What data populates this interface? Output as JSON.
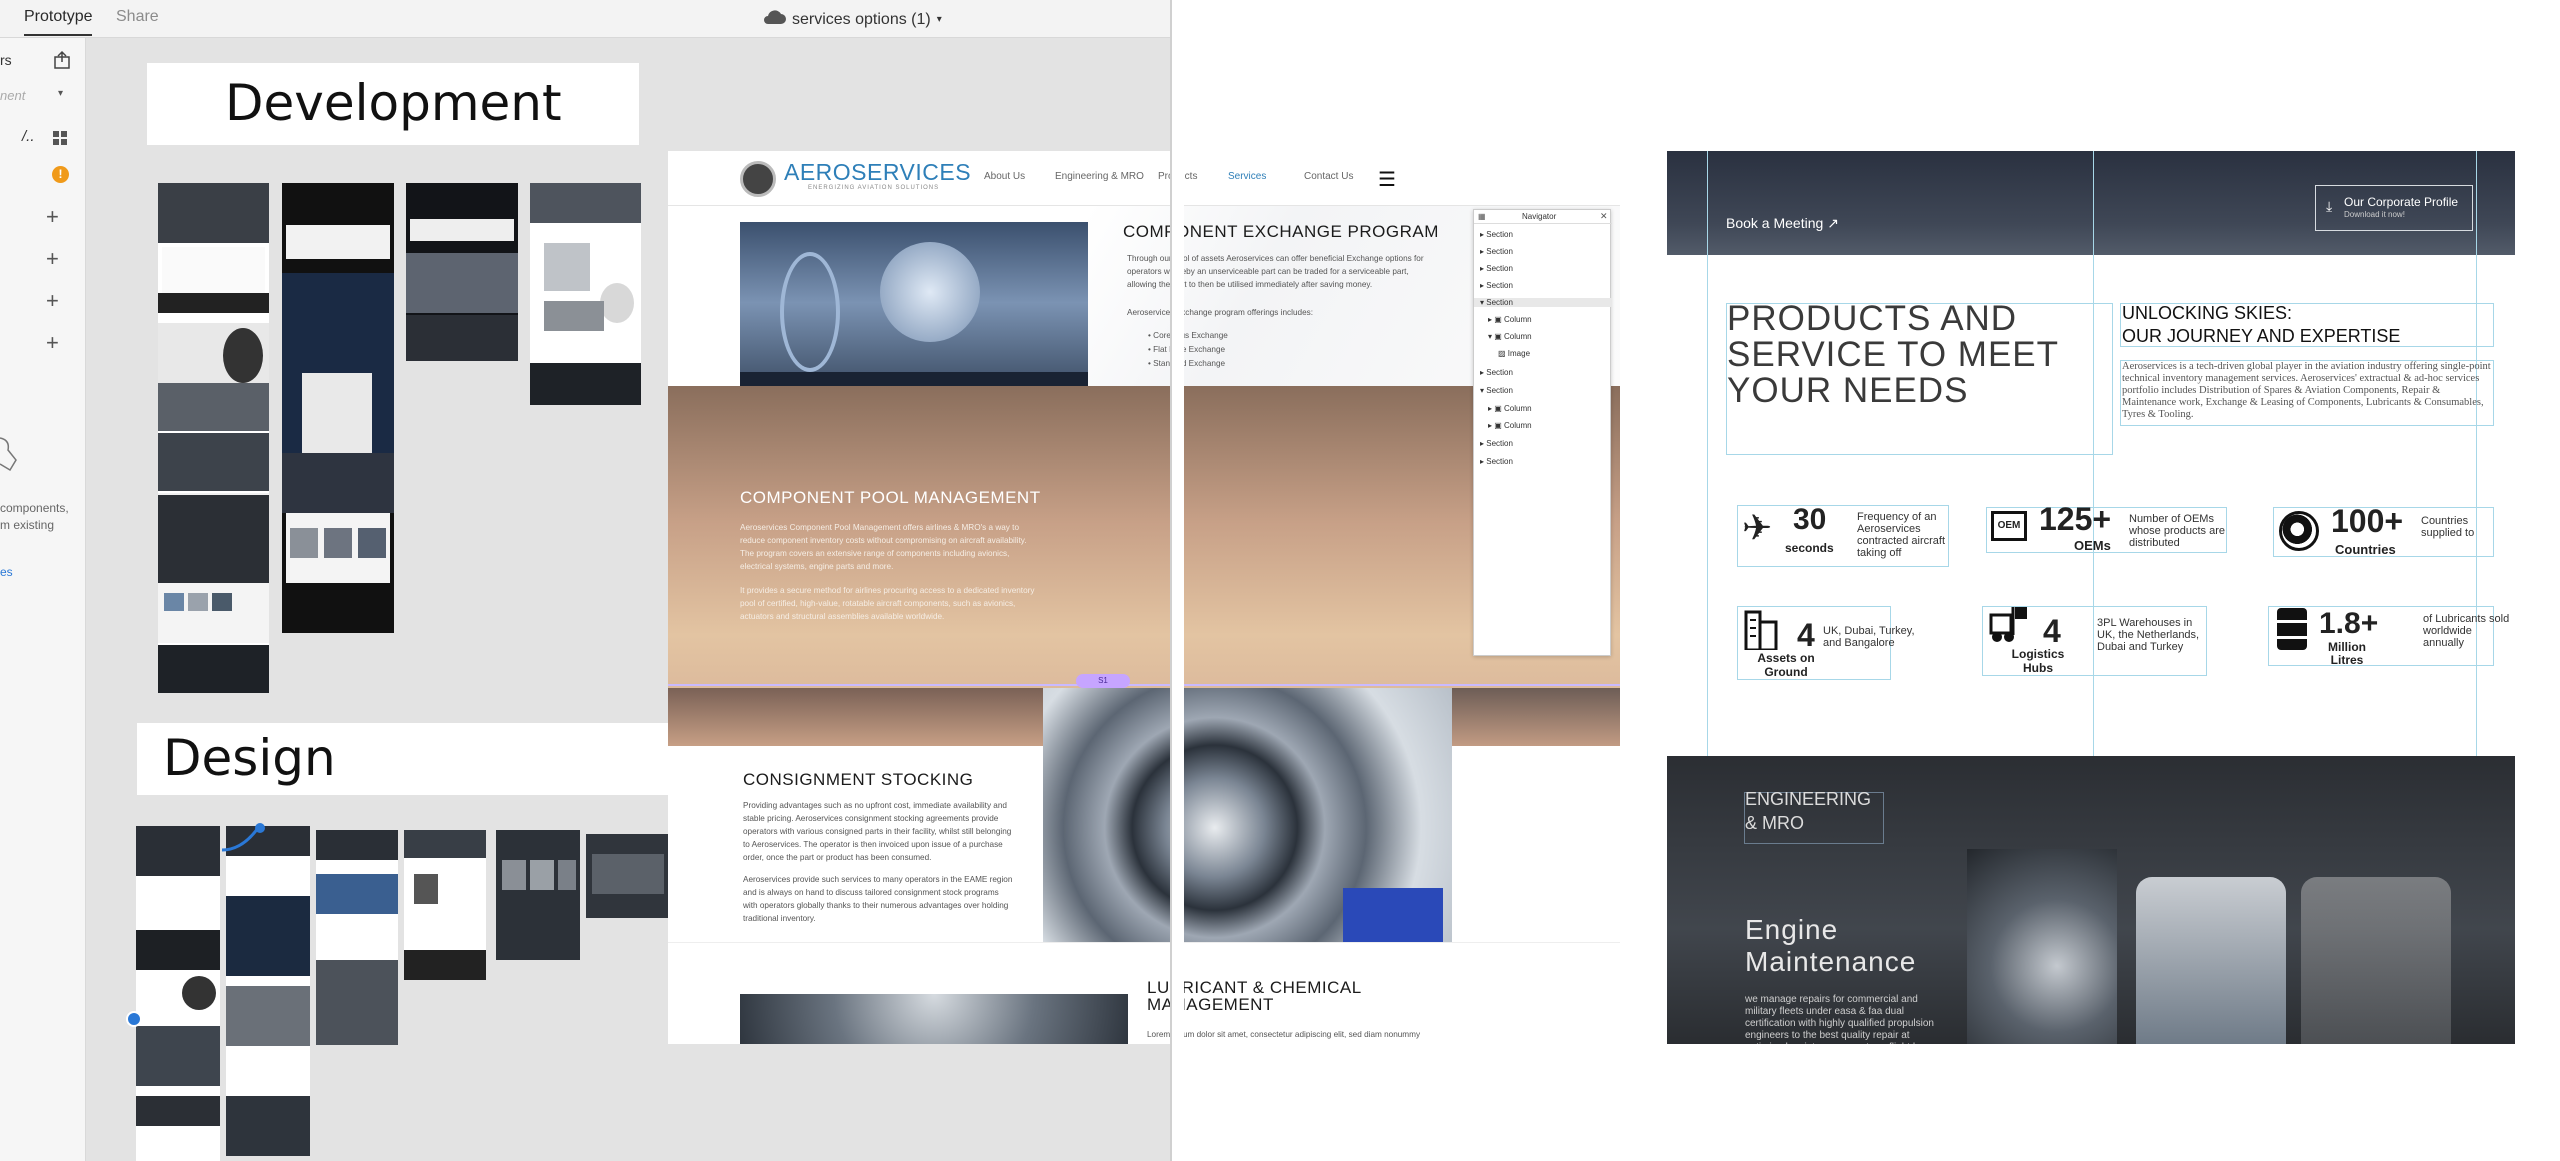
{
  "topbar": {
    "tabs": [
      "Prototype",
      "Share"
    ],
    "doc_title": "services options (1)"
  },
  "left_panel": {
    "letter": "rs",
    "dropdown_text": "nent",
    "hint_lines": [
      "components,",
      "m existing"
    ],
    "link_text": "es"
  },
  "canvas": {
    "development_label": "Development",
    "design_label": "Design"
  },
  "main_page": {
    "brand": "AEROSERVICES",
    "brand_tagline": "ENERGIZING AVIATION SOLUTIONS",
    "nav": [
      "About Us",
      "Engineering & MRO",
      "Products",
      "Services",
      "Contact Us"
    ],
    "sections": {
      "exchange_title": "COMPONENT EXCHANGE PROGRAM",
      "exchange_text": "Through our pool of assets Aeroservices can offer beneficial Exchange options for operators whereby an unserviceable part can be traded for a serviceable part, allowing the part to then be utilised immediately after saving money.",
      "exchange_intro": "Aeroservices exchange program offerings includes:",
      "exchange_list": [
        "Core Plus Exchange",
        "Flat Rate Exchange",
        "Standard Exchange"
      ],
      "pool_title": "COMPONENT POOL MANAGEMENT",
      "pool_text": "Aeroservices Component Pool Management offers airlines & MRO's a way to reduce component inventory costs without compromising on aircraft availability. The program covers an extensive range of components including avionics, electrical systems, engine parts and more.",
      "pool_text2": "It provides a secure method for airlines procuring access to a dedicated inventory pool of certified, high-value, rotatable aircraft components, such as avionics, actuators and structural assemblies available worldwide.",
      "consignment_title": "CONSIGNMENT STOCKING",
      "consignment_text": "Providing advantages such as no upfront cost, immediate availability and stable pricing. Aeroservices consignment stocking agreements provide operators with various consigned parts in their facility, whilst still belonging to Aeroservices. The operator is then invoiced upon issue of a purchase order, once the part or product has been consumed.",
      "consignment_text2": "Aeroservices provide such services to many operators in the EAME region and is always on hand to discuss tailored consignment stock programs with operators globally thanks to their numerous advantages over holding traditional inventory.",
      "lubricant_title": "LUBRICANT & CHEMICAL MANAGEMENT",
      "lubricant_text": "Lorem ipsum dolor sit amet, consectetur adipiscing elit, sed diam nonummy nibh euismod tincidunt ut laoreet dolore magna aliquam"
    },
    "navigator": {
      "title": "Navigator",
      "rows": [
        "Section",
        "Section",
        "Section",
        "Section",
        "Section",
        "Column",
        "Column",
        "Image",
        "Section",
        "Section",
        "Column",
        "Column",
        "Section",
        "Section"
      ]
    },
    "selection_badge": "S1"
  },
  "right_page": {
    "book_meeting": "Book a Meeting",
    "profile_title": "Our Corporate Profile",
    "profile_sub": "Download it now!",
    "headline_lines": [
      "PRODUCTS AND",
      "SERVICE TO MEET",
      "YOUR NEEDS"
    ],
    "subhead_lines": [
      "UNLOCKING SKIES:",
      "OUR JOURNEY AND EXPERTISE"
    ],
    "about_text": "Aeroservices is a tech-driven global player in the aviation industry offering single-point technical inventory management services. Aeroservices' extractual & ad-hoc services portfolio includes Distribution of Spares & Aviation Components, Repair & Maintenance work, Exchange & Leasing of Components, Lubricants & Consumables, Tyres & Tooling.",
    "stats": [
      {
        "icon": "plane-icon",
        "num": "30",
        "unit": "seconds",
        "desc": "Frequency of an Aeroservices contracted aircraft taking off"
      },
      {
        "icon": "oem-icon",
        "num": "125+",
        "unit": "OEMs",
        "desc": "Number of OEMs whose products are distributed"
      },
      {
        "icon": "globe-icon",
        "num": "100+",
        "unit": "Countries",
        "desc": "Countries supplied to"
      },
      {
        "icon": "building-icon",
        "num": "4",
        "unit": "Assets on Ground",
        "desc": "UK, Dubai, Turkey, and Bangalore"
      },
      {
        "icon": "forklift-icon",
        "num": "4",
        "unit": "Logistics Hubs",
        "desc": "3PL Warehouses in UK, the Netherlands, Dubai and Turkey"
      },
      {
        "icon": "barrel-icon",
        "num": "1.8+",
        "unit": "Million Litres",
        "desc": "of Lubricants sold worldwide annually"
      }
    ],
    "eng_label_lines": [
      "ENGINEERING",
      "& MRO"
    ],
    "engine_title_lines": [
      "Engine",
      "Maintenance"
    ],
    "engine_text": "we manage repairs for commercial and military fleets under easa & faa dual certification with highly qualified propulsion engineers to the best quality repair at optimized maintenance cost per flight hour"
  }
}
